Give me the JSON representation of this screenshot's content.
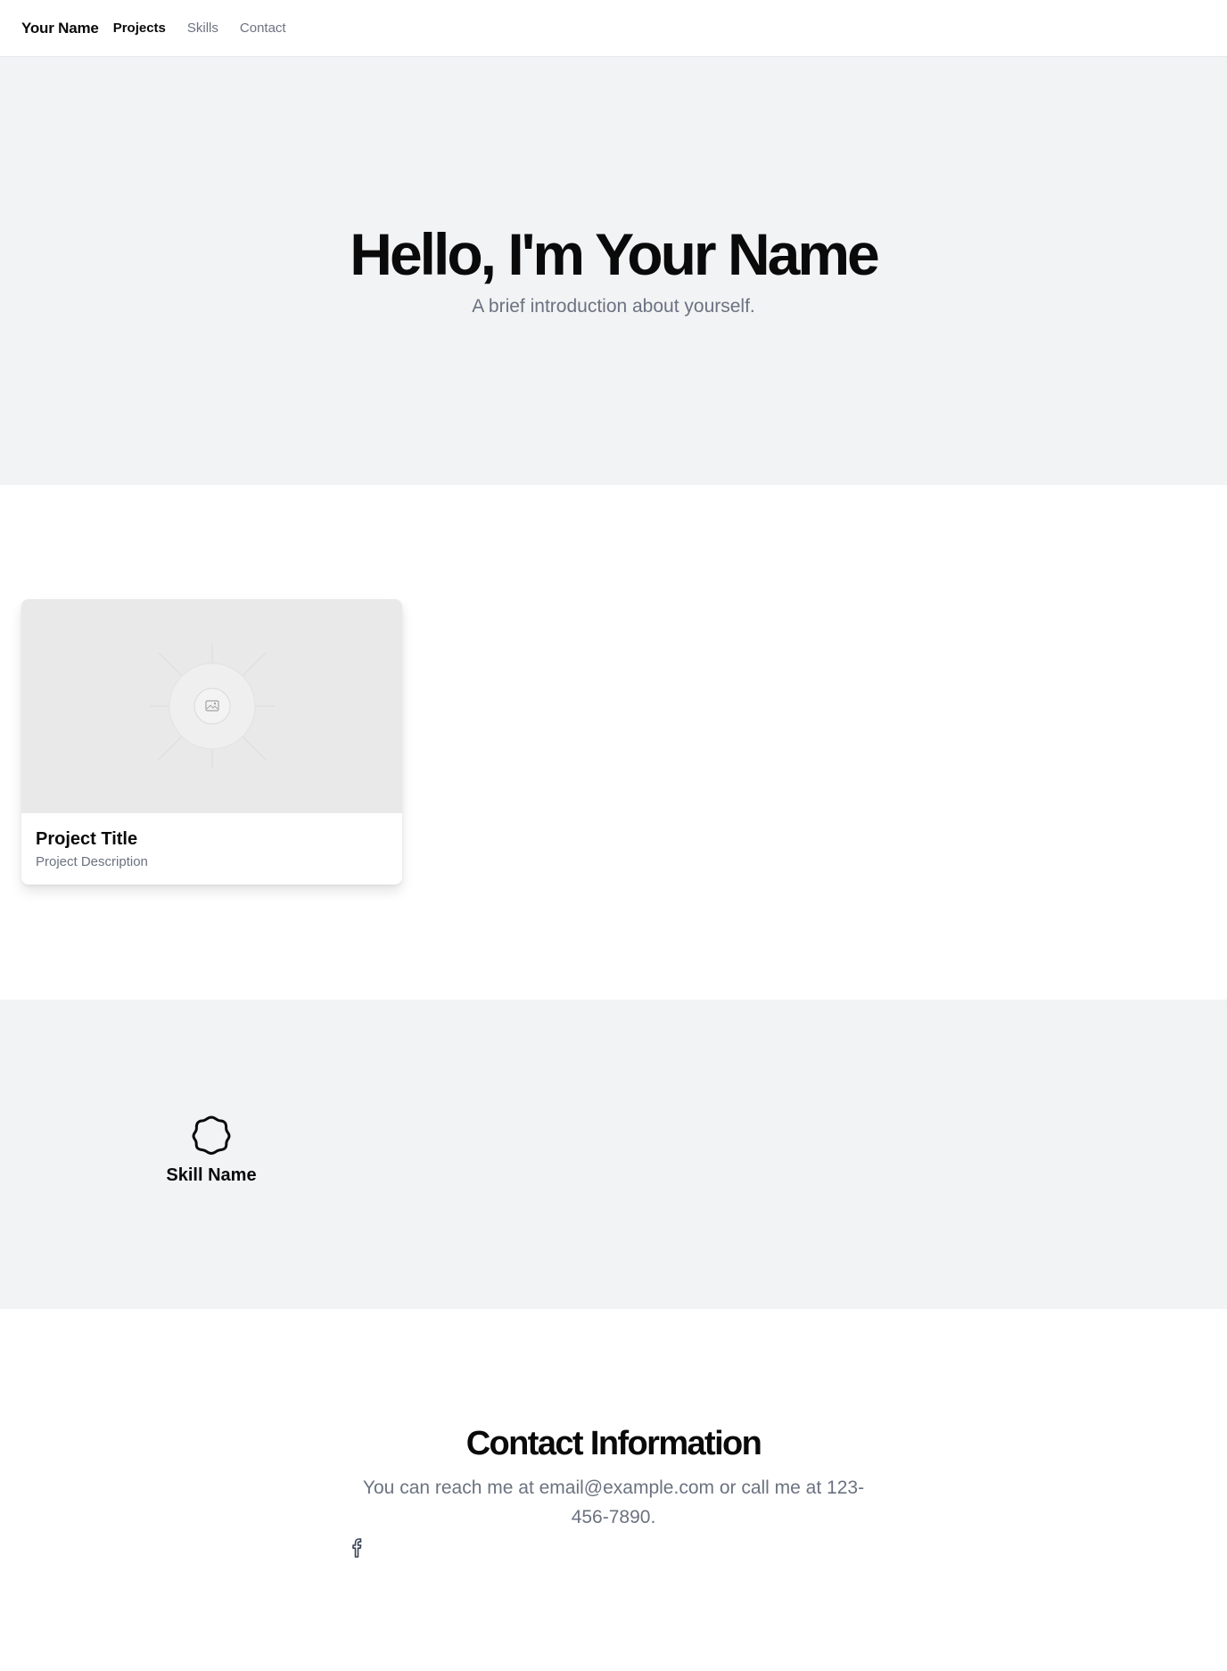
{
  "nav": {
    "brand": "Your Name",
    "links": [
      "Projects",
      "Skills",
      "Contact"
    ],
    "active": "Projects"
  },
  "hero": {
    "title": "Hello, I'm Your Name",
    "subtitle": "A brief introduction about yourself."
  },
  "projects": [
    {
      "title": "Project Title",
      "description": "Project Description",
      "image_icon": "image-placeholder-icon"
    }
  ],
  "skills": [
    {
      "name": "Skill Name",
      "icon": "badge-icon"
    }
  ],
  "contact": {
    "title": "Contact Information",
    "text": "You can reach me at email@example.com or call me at 123-456-7890.",
    "social_icons": [
      "facebook-icon"
    ]
  },
  "colors": {
    "section_gray": "#f2f3f5",
    "muted_text": "#6b7280",
    "heading_text": "#0a0a0a",
    "border": "#e5e7eb"
  }
}
